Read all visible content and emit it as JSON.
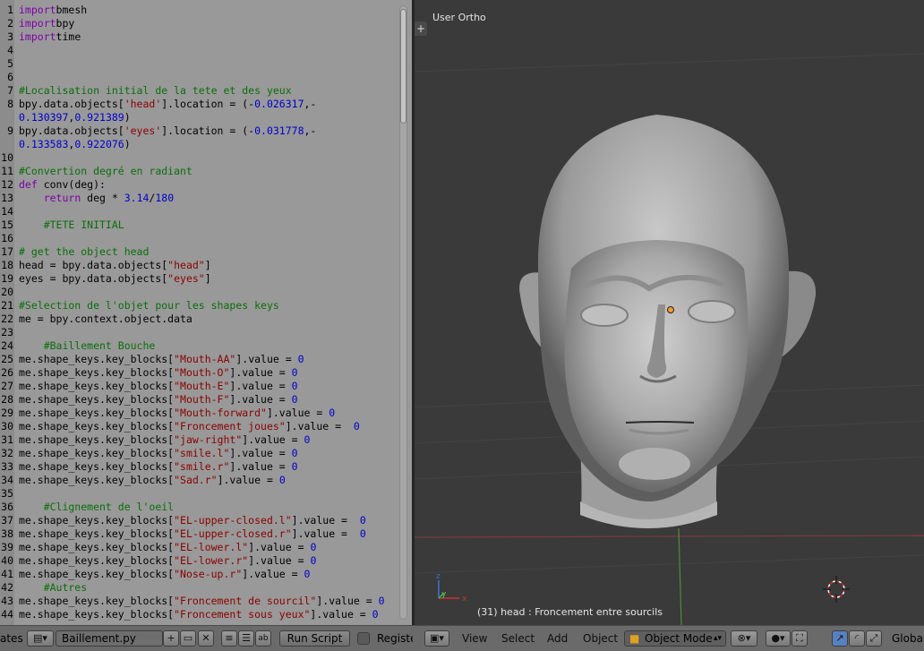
{
  "editor": {
    "lines": [
      {
        "n": "1",
        "segs": [
          [
            "kw",
            "import"
          ],
          [
            "",
            "bmesh"
          ]
        ]
      },
      {
        "n": "2",
        "segs": [
          [
            "kw",
            "import"
          ],
          [
            "",
            "bpy"
          ]
        ]
      },
      {
        "n": "3",
        "segs": [
          [
            "kw",
            "import"
          ],
          [
            "",
            "time"
          ]
        ]
      },
      {
        "n": "4",
        "segs": []
      },
      {
        "n": "5",
        "segs": []
      },
      {
        "n": "6",
        "segs": []
      },
      {
        "n": "7",
        "segs": [
          [
            "cm",
            "#Localisation initial de la tete et des yeux"
          ]
        ]
      },
      {
        "n": "8",
        "segs": [
          [
            "",
            "bpy.data.objects["
          ],
          [
            "st",
            "'head'"
          ],
          [
            "",
            "].location = (-"
          ],
          [
            "nm",
            "0.026317"
          ],
          [
            "",
            ",-"
          ]
        ]
      },
      {
        "n": "",
        "segs": [
          [
            "nm",
            "0.130397"
          ],
          [
            "",
            ","
          ],
          [
            "nm",
            "0.921389"
          ],
          [
            "",
            ")"
          ]
        ]
      },
      {
        "n": "9",
        "segs": [
          [
            "",
            "bpy.data.objects["
          ],
          [
            "st",
            "'eyes'"
          ],
          [
            "",
            "].location = (-"
          ],
          [
            "nm",
            "0.031778"
          ],
          [
            "",
            ",-"
          ]
        ]
      },
      {
        "n": "",
        "segs": [
          [
            "nm",
            "0.133583"
          ],
          [
            "",
            ","
          ],
          [
            "nm",
            "0.922076"
          ],
          [
            "",
            ")"
          ]
        ]
      },
      {
        "n": "10",
        "segs": []
      },
      {
        "n": "11",
        "segs": [
          [
            "cm",
            "#Convertion degré en radiant"
          ]
        ]
      },
      {
        "n": "12",
        "segs": [
          [
            "kw",
            "def"
          ],
          [
            "",
            " conv(deg):"
          ]
        ]
      },
      {
        "n": "13",
        "segs": [
          [
            "",
            "    "
          ],
          [
            "kw",
            "return"
          ],
          [
            "",
            " deg * "
          ],
          [
            "nm",
            "3.14"
          ],
          [
            "",
            "/"
          ],
          [
            "nm",
            "180"
          ]
        ]
      },
      {
        "n": "14",
        "segs": []
      },
      {
        "n": "15",
        "segs": [
          [
            "cm",
            "    #TETE INITIAL"
          ]
        ]
      },
      {
        "n": "16",
        "segs": []
      },
      {
        "n": "17",
        "segs": [
          [
            "cm",
            "# get the object head"
          ]
        ]
      },
      {
        "n": "18",
        "segs": [
          [
            "",
            "head = bpy.data.objects["
          ],
          [
            "st",
            "\"head\""
          ],
          [
            "",
            "]"
          ]
        ]
      },
      {
        "n": "19",
        "segs": [
          [
            "",
            "eyes = bpy.data.objects["
          ],
          [
            "st",
            "\"eyes\""
          ],
          [
            "",
            "]"
          ]
        ]
      },
      {
        "n": "20",
        "segs": []
      },
      {
        "n": "21",
        "segs": [
          [
            "cm",
            "#Selection de l'objet pour les shapes keys"
          ]
        ]
      },
      {
        "n": "22",
        "segs": [
          [
            "",
            "me = bpy.context.object.data"
          ]
        ]
      },
      {
        "n": "23",
        "segs": []
      },
      {
        "n": "24",
        "segs": [
          [
            "cm",
            "    #Baillement Bouche"
          ]
        ]
      },
      {
        "n": "25",
        "segs": [
          [
            "",
            "me.shape_keys.key_blocks["
          ],
          [
            "st",
            "\"Mouth-AA\""
          ],
          [
            "",
            "].value = "
          ],
          [
            "nm",
            "0"
          ]
        ]
      },
      {
        "n": "26",
        "segs": [
          [
            "",
            "me.shape_keys.key_blocks["
          ],
          [
            "st",
            "\"Mouth-O\""
          ],
          [
            "",
            "].value = "
          ],
          [
            "nm",
            "0"
          ]
        ]
      },
      {
        "n": "27",
        "segs": [
          [
            "",
            "me.shape_keys.key_blocks["
          ],
          [
            "st",
            "\"Mouth-E\""
          ],
          [
            "",
            "].value = "
          ],
          [
            "nm",
            "0"
          ]
        ]
      },
      {
        "n": "28",
        "segs": [
          [
            "",
            "me.shape_keys.key_blocks["
          ],
          [
            "st",
            "\"Mouth-F\""
          ],
          [
            "",
            "].value = "
          ],
          [
            "nm",
            "0"
          ]
        ]
      },
      {
        "n": "29",
        "segs": [
          [
            "",
            "me.shape_keys.key_blocks["
          ],
          [
            "st",
            "\"Mouth-forward\""
          ],
          [
            "",
            "].value = "
          ],
          [
            "nm",
            "0"
          ]
        ]
      },
      {
        "n": "30",
        "segs": [
          [
            "",
            "me.shape_keys.key_blocks["
          ],
          [
            "st",
            "\"Froncement joues\""
          ],
          [
            "",
            "].value =  "
          ],
          [
            "nm",
            "0"
          ]
        ]
      },
      {
        "n": "31",
        "segs": [
          [
            "",
            "me.shape_keys.key_blocks["
          ],
          [
            "st",
            "\"jaw-right\""
          ],
          [
            "",
            "].value = "
          ],
          [
            "nm",
            "0"
          ]
        ]
      },
      {
        "n": "32",
        "segs": [
          [
            "",
            "me.shape_keys.key_blocks["
          ],
          [
            "st",
            "\"smile.l\""
          ],
          [
            "",
            "].value = "
          ],
          [
            "nm",
            "0"
          ]
        ]
      },
      {
        "n": "33",
        "segs": [
          [
            "",
            "me.shape_keys.key_blocks["
          ],
          [
            "st",
            "\"smile.r\""
          ],
          [
            "",
            "].value = "
          ],
          [
            "nm",
            "0"
          ]
        ]
      },
      {
        "n": "34",
        "segs": [
          [
            "",
            "me.shape_keys.key_blocks["
          ],
          [
            "st",
            "\"Sad.r\""
          ],
          [
            "",
            "].value = "
          ],
          [
            "nm",
            "0"
          ]
        ]
      },
      {
        "n": "35",
        "segs": []
      },
      {
        "n": "36",
        "segs": [
          [
            "cm",
            "    #Clignement de l'oeil"
          ]
        ]
      },
      {
        "n": "37",
        "segs": [
          [
            "",
            "me.shape_keys.key_blocks["
          ],
          [
            "st",
            "\"EL-upper-closed.l\""
          ],
          [
            "",
            "].value =  "
          ],
          [
            "nm",
            "0"
          ]
        ]
      },
      {
        "n": "38",
        "segs": [
          [
            "",
            "me.shape_keys.key_blocks["
          ],
          [
            "st",
            "\"EL-upper-closed.r\""
          ],
          [
            "",
            "].value =  "
          ],
          [
            "nm",
            "0"
          ]
        ]
      },
      {
        "n": "39",
        "segs": [
          [
            "",
            "me.shape_keys.key_blocks["
          ],
          [
            "st",
            "\"EL-lower.l\""
          ],
          [
            "",
            "].value = "
          ],
          [
            "nm",
            "0"
          ]
        ]
      },
      {
        "n": "40",
        "segs": [
          [
            "",
            "me.shape_keys.key_blocks["
          ],
          [
            "st",
            "\"EL-lower.r\""
          ],
          [
            "",
            "].value = "
          ],
          [
            "nm",
            "0"
          ]
        ]
      },
      {
        "n": "41",
        "segs": [
          [
            "",
            "me.shape_keys.key_blocks["
          ],
          [
            "st",
            "\"Nose-up.r\""
          ],
          [
            "",
            "].value = "
          ],
          [
            "nm",
            "0"
          ]
        ]
      },
      {
        "n": "42",
        "segs": [
          [
            "cm",
            "    #Autres"
          ]
        ]
      },
      {
        "n": "43",
        "segs": [
          [
            "",
            "me.shape_keys.key_blocks["
          ],
          [
            "st",
            "\"Froncement de sourcil\""
          ],
          [
            "",
            "].value = "
          ],
          [
            "nm",
            "0"
          ]
        ]
      },
      {
        "n": "44",
        "segs": [
          [
            "",
            "me.shape_keys.key_blocks["
          ],
          [
            "st",
            "\"Froncement sous yeux\""
          ],
          [
            "",
            "].value = "
          ],
          [
            "nm",
            "0"
          ]
        ]
      }
    ]
  },
  "viewport": {
    "view_label": "User Ortho",
    "plus_label": "+",
    "status": "(31) head : Froncement entre sourcils",
    "axis_x": "x",
    "axis_y": "y",
    "axis_z": "z"
  },
  "text_header": {
    "left_stub": "ates",
    "filename": "Baillement.py",
    "run_script": "Run Script",
    "register": "Register"
  },
  "view3d_header": {
    "menus": [
      "View",
      "Select",
      "Add",
      "Object"
    ],
    "mode": "Object Mode",
    "orientation": "Global"
  },
  "colors": {
    "editor_bg": "#999999",
    "viewport_bg": "#3a3a3a",
    "keyword": "#7f00a8",
    "string": "#8b0000",
    "number": "#0000cc",
    "comment": "#0a6e0a"
  }
}
